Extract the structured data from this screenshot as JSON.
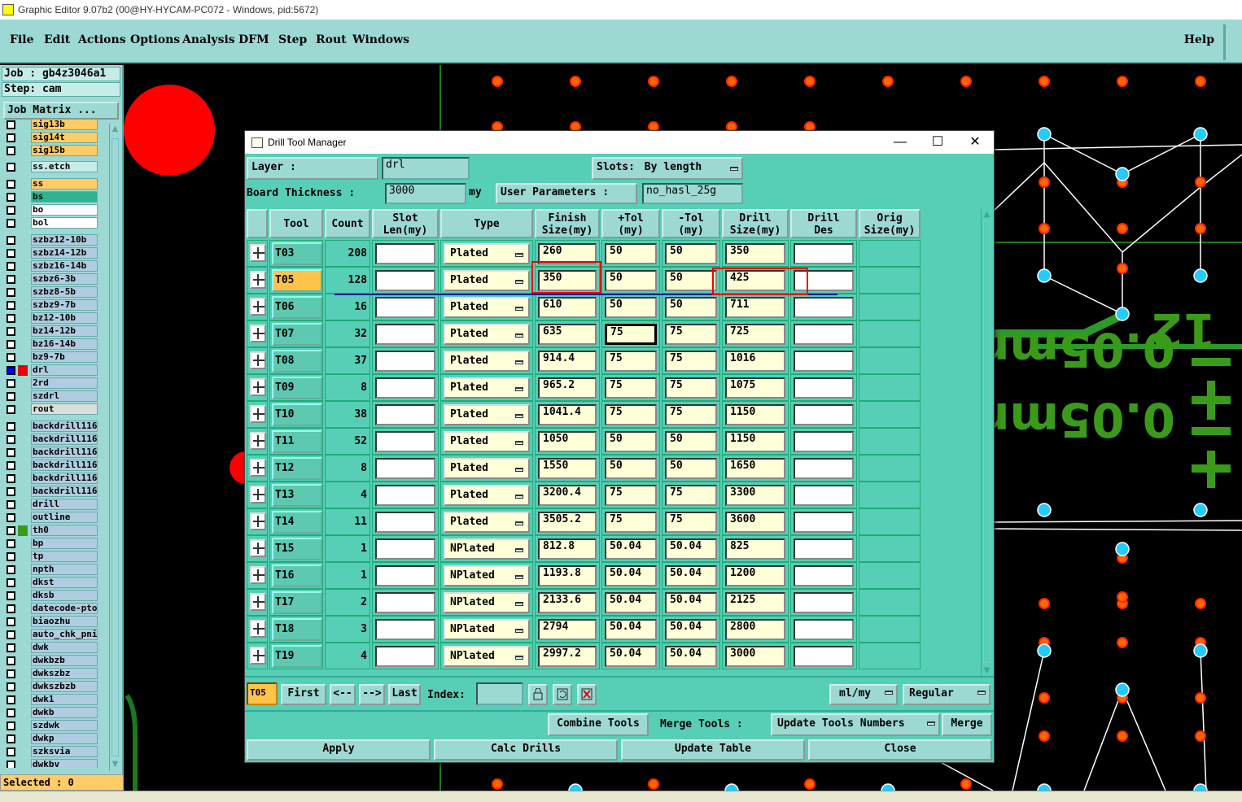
{
  "window": {
    "title": "Graphic Editor 9.07b2 (00@HY-HYCAM-PC072 - Windows, pid:5672)"
  },
  "menu": {
    "items": [
      "File",
      "Edit",
      "Actions",
      "Options",
      "Analysis",
      "DFM",
      "Step",
      "Rout",
      "Windows"
    ],
    "help": "Help"
  },
  "job": {
    "job_line": "Job : gb4z3046a1",
    "step_line": "Step: cam",
    "matrix_button": "Job Matrix ..."
  },
  "layers": [
    {
      "name": "sig13b",
      "color": "#ffcc66"
    },
    {
      "name": "sig14t",
      "color": "#ffcc66"
    },
    {
      "name": "sig15b",
      "color": "#ffcc66"
    },
    {
      "name": "ss.etch",
      "color": "#c6ece8"
    },
    {
      "name": "ss",
      "color": "#ffcc66"
    },
    {
      "name": "bs",
      "color": "#2fb38f"
    },
    {
      "name": "bo",
      "color": "#ffffff"
    },
    {
      "name": "bol",
      "color": "#ffffff"
    },
    {
      "name": "szbz12-10b",
      "color": "#b0cce0"
    },
    {
      "name": "szbz14-12b",
      "color": "#b0cce0"
    },
    {
      "name": "szbz16-14b",
      "color": "#b0cce0"
    },
    {
      "name": "szbz6-3b",
      "color": "#b0cce0"
    },
    {
      "name": "szbz8-5b",
      "color": "#b0cce0"
    },
    {
      "name": "szbz9-7b",
      "color": "#b0cce0"
    },
    {
      "name": "bz12-10b",
      "color": "#b0cce0"
    },
    {
      "name": "bz14-12b",
      "color": "#b0cce0"
    },
    {
      "name": "bz16-14b",
      "color": "#b0cce0"
    },
    {
      "name": "bz9-7b",
      "color": "#b0cce0"
    },
    {
      "name": "drl",
      "color": "#b0cce0"
    },
    {
      "name": "2rd",
      "color": "#b0cce0"
    },
    {
      "name": "szdrl",
      "color": "#b0cce0"
    },
    {
      "name": "rout",
      "color": "#dddddd"
    },
    {
      "name": "backdrill116-",
      "color": "#b0cce0"
    },
    {
      "name": "backdrill116-",
      "color": "#b0cce0"
    },
    {
      "name": "backdrill116-",
      "color": "#b0cce0"
    },
    {
      "name": "backdrill116-",
      "color": "#b0cce0"
    },
    {
      "name": "backdrill116-",
      "color": "#b0cce0"
    },
    {
      "name": "backdrill116-",
      "color": "#b0cce0"
    },
    {
      "name": "drill",
      "color": "#b0cce0"
    },
    {
      "name": "outline",
      "color": "#b0cce0"
    },
    {
      "name": "th0",
      "color": "#b0cce0"
    },
    {
      "name": "bp",
      "color": "#b0cce0"
    },
    {
      "name": "tp",
      "color": "#b0cce0"
    },
    {
      "name": "npth",
      "color": "#b0cce0"
    },
    {
      "name": "dkst",
      "color": "#b0cce0"
    },
    {
      "name": "dksb",
      "color": "#b0cce0"
    },
    {
      "name": "datecode-pto",
      "color": "#b0cce0"
    },
    {
      "name": "biaozhu",
      "color": "#b0cce0"
    },
    {
      "name": "auto_chk_pni",
      "color": "#b0cce0"
    },
    {
      "name": "dwk",
      "color": "#b0cce0"
    },
    {
      "name": "dwkbzb",
      "color": "#b0cce0"
    },
    {
      "name": "dwkszbz",
      "color": "#b0cce0"
    },
    {
      "name": "dwkszbzb",
      "color": "#b0cce0"
    },
    {
      "name": "dwk1",
      "color": "#b0cce0"
    },
    {
      "name": "dwkb",
      "color": "#b0cce0"
    },
    {
      "name": "szdwk",
      "color": "#b0cce0"
    },
    {
      "name": "dwkp",
      "color": "#b0cce0"
    },
    {
      "name": "szksvia",
      "color": "#b0cce0"
    },
    {
      "name": "dwkbv",
      "color": "#b0cce0"
    }
  ],
  "selected": "Selected : 0",
  "canvas": {
    "text1": "0.05mm",
    "text2": "0.05mm",
    "text3": "12"
  },
  "dialog": {
    "title": "Drill Tool Manager",
    "layer_label": "Layer          :",
    "layer_value": "drl",
    "slots_label": "Slots:",
    "slots_value": "By length",
    "thickness_label": "Board Thickness :",
    "thickness_value": "3000",
    "thickness_unit": "my",
    "user_params_label": "User Parameters :",
    "user_params_value": "no_hasl_25g",
    "headers": [
      {
        "l1": "",
        "l2": ""
      },
      {
        "l1": "Tool",
        "l2": ""
      },
      {
        "l1": "Count",
        "l2": ""
      },
      {
        "l1": "Slot",
        "l2": "Len(my)"
      },
      {
        "l1": "Type",
        "l2": ""
      },
      {
        "l1": "Finish",
        "l2": "Size(my)"
      },
      {
        "l1": "+Tol",
        "l2": "(my)"
      },
      {
        "l1": "-Tol",
        "l2": "(my)"
      },
      {
        "l1": "Drill",
        "l2": "Size(my)"
      },
      {
        "l1": "Drill",
        "l2": "Des"
      },
      {
        "l1": "Orig",
        "l2": "Size(my)"
      }
    ],
    "rows": [
      {
        "tool": "T03",
        "count": "208",
        "type": "Plated",
        "finish": "260",
        "ptol": "50",
        "mtol": "50",
        "drill": "350"
      },
      {
        "tool": "T05",
        "count": "128",
        "type": "Plated",
        "finish": "350",
        "ptol": "50",
        "mtol": "50",
        "drill": "425"
      },
      {
        "tool": "T06",
        "count": "16",
        "type": "Plated",
        "finish": "610",
        "ptol": "50",
        "mtol": "50",
        "drill": "711"
      },
      {
        "tool": "T07",
        "count": "32",
        "type": "Plated",
        "finish": "635",
        "ptol": "75",
        "mtol": "75",
        "drill": "725"
      },
      {
        "tool": "T08",
        "count": "37",
        "type": "Plated",
        "finish": "914.4",
        "ptol": "75",
        "mtol": "75",
        "drill": "1016"
      },
      {
        "tool": "T09",
        "count": "8",
        "type": "Plated",
        "finish": "965.2",
        "ptol": "75",
        "mtol": "75",
        "drill": "1075"
      },
      {
        "tool": "T10",
        "count": "38",
        "type": "Plated",
        "finish": "1041.4",
        "ptol": "75",
        "mtol": "75",
        "drill": "1150"
      },
      {
        "tool": "T11",
        "count": "52",
        "type": "Plated",
        "finish": "1050",
        "ptol": "50",
        "mtol": "50",
        "drill": "1150"
      },
      {
        "tool": "T12",
        "count": "8",
        "type": "Plated",
        "finish": "1550",
        "ptol": "50",
        "mtol": "50",
        "drill": "1650"
      },
      {
        "tool": "T13",
        "count": "4",
        "type": "Plated",
        "finish": "3200.4",
        "ptol": "75",
        "mtol": "75",
        "drill": "3300"
      },
      {
        "tool": "T14",
        "count": "11",
        "type": "Plated",
        "finish": "3505.2",
        "ptol": "75",
        "mtol": "75",
        "drill": "3600"
      },
      {
        "tool": "T15",
        "count": "1",
        "type": "NPlated",
        "finish": "812.8",
        "ptol": "50.04",
        "mtol": "50.04",
        "drill": "825"
      },
      {
        "tool": "T16",
        "count": "1",
        "type": "NPlated",
        "finish": "1193.8",
        "ptol": "50.04",
        "mtol": "50.04",
        "drill": "1200"
      },
      {
        "tool": "T17",
        "count": "2",
        "type": "NPlated",
        "finish": "2133.6",
        "ptol": "50.04",
        "mtol": "50.04",
        "drill": "2125"
      },
      {
        "tool": "T18",
        "count": "3",
        "type": "NPlated",
        "finish": "2794",
        "ptol": "50.04",
        "mtol": "50.04",
        "drill": "2800"
      },
      {
        "tool": "T19",
        "count": "4",
        "type": "NPlated",
        "finish": "2997.2",
        "ptol": "50.04",
        "mtol": "50.04",
        "drill": "3000"
      }
    ],
    "current_tool": "T05",
    "nav": {
      "first": "First",
      "prev": "<--",
      "next": "-->",
      "last": "Last",
      "index_label": "Index:",
      "index_value": "",
      "units": "ml/my",
      "mode": "Regular"
    },
    "merge": {
      "combine": "Combine Tools",
      "merge_label": "Merge Tools :",
      "update_numbers": "Update Tools Numbers",
      "merge": "Merge"
    },
    "actions": {
      "apply": "Apply",
      "calc": "Calc Drills",
      "update": "Update Table",
      "close": "Close"
    }
  }
}
